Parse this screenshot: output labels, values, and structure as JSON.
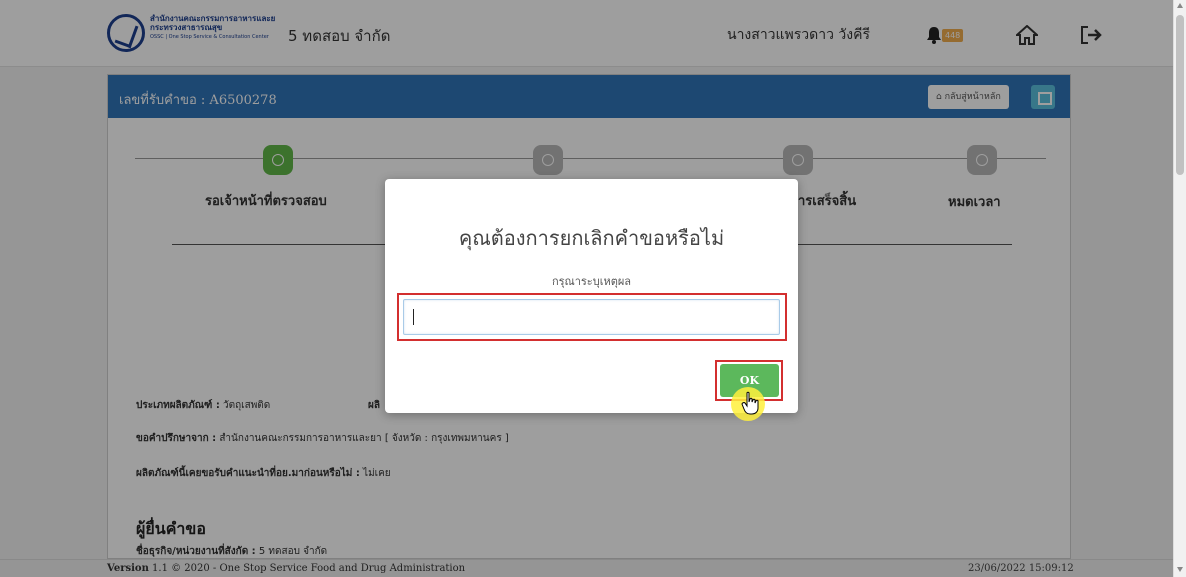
{
  "header": {
    "logo_line1": "สำนักงานคณะกรรมการอาหารและยา",
    "logo_line2": "กระทรวงสาธารณสุข",
    "logo_line3": "OSSC | One Stop Service & Consultation Center",
    "company": "5 ทดสอบ จำกัด",
    "user_name": "นางสาวแพรวดาว วังคีรี",
    "notification_count": "448"
  },
  "panel": {
    "title": "เลขที่รับคำขอ : A6500278",
    "back_label": "กลับสู่หน้าหลัก"
  },
  "steps": [
    {
      "label": "รอเจ้าหน้าที่ตรวจสอบ",
      "active": true
    },
    {
      "label": "",
      "active": false
    },
    {
      "label": "ารเสร็จสิ้น",
      "active": false
    },
    {
      "label": "หมดเวลา",
      "active": false
    }
  ],
  "details": {
    "product_type_label": "ประเภทผลิตภัณฑ์ :",
    "product_type_value": "วัตถุเสพติด",
    "product_col2_label": "ผลิ",
    "consult_from_label": "ขอคำปรึกษาจาก :",
    "consult_from_value": "สำนักงานคณะกรรมการอาหารและยา [ จังหวัด : กรุงเทพมหานคร ]",
    "ever_consulted_label": "ผลิตภัณฑ์นี้เคยขอรับคำแนะนำที่อย.มาก่อนหรือไม่ :",
    "ever_consulted_value": "ไม่เคย",
    "applicant_heading": "ผู้ยื่นคำขอ",
    "business_label": "ชื่อธุรกิจ/หน่วยงานที่สังกัด :",
    "business_value": "5 ทดสอบ จำกัด"
  },
  "modal": {
    "title": "คุณต้องการยกเลิกคำขอหรือไม่",
    "subtitle": "กรุณาระบุเหตุผล",
    "input_value": "",
    "ok_label": "OK"
  },
  "footer": {
    "version_label": "Version",
    "version_text": " 1.1 © 2020 - One Stop Service Food and Drug Administration",
    "datetime": "23/06/2022 15:09:12"
  }
}
